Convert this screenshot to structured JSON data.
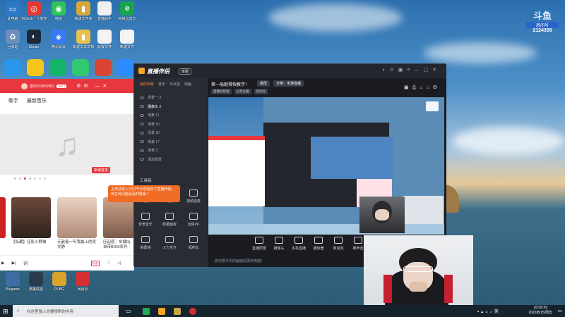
{
  "douyu": {
    "logo": "斗鱼",
    "room_label": "房间号",
    "room_number": "2124309"
  },
  "desktop_icons": [
    {
      "label": "此电脑",
      "color": "#2c79c9",
      "glyph": "▭"
    },
    {
      "label": "ToDesk一个软件",
      "color": "#e53935",
      "glyph": "◎"
    },
    {
      "label": "微信",
      "color": "#2ec35b",
      "glyph": "◉"
    },
    {
      "label": "新建文件夹",
      "color": "#d6a93a",
      "glyph": "▮"
    },
    {
      "label": "直播助手",
      "color": "#f0f0f0",
      "glyph": "▭"
    },
    {
      "label": "网易云音乐",
      "color": "#19a34a",
      "glyph": "e"
    },
    {
      "label": "回收站",
      "color": "#6d8ebd",
      "glyph": "♻"
    },
    {
      "label": "Steam",
      "color": "#1b2838",
      "glyph": "◐"
    },
    {
      "label": "腾讯会议",
      "color": "#3979f7",
      "glyph": "◈"
    },
    {
      "label": "新建文本文档",
      "color": "#e8c24a",
      "glyph": "▮"
    },
    {
      "label": "配置文件",
      "color": "#f3f3f3",
      "glyph": "▭"
    },
    {
      "label": "新建文件",
      "color": "#f3f3f3",
      "glyph": "▭"
    }
  ],
  "row3_icons": [
    {
      "color": "#2a95ea"
    },
    {
      "color": "#f5c518"
    },
    {
      "color": "#14b36a"
    },
    {
      "color": "#31c96f"
    },
    {
      "color": "#d84532"
    },
    {
      "color": "#2a8cff"
    }
  ],
  "bottom_icons": [
    {
      "label": "Wegame",
      "color": "#3d6ea3"
    },
    {
      "label": "英雄联盟",
      "color": "#2a3b4e"
    },
    {
      "label": "PUBG",
      "color": "#d8a32f"
    },
    {
      "label": "网易云",
      "color": "#d42f33"
    }
  ],
  "music": {
    "user": "音乐ID2825961",
    "vip": "VIP 1",
    "nav": [
      "歌手",
      "最新音乐"
    ],
    "badge": "新歌首发",
    "cards": [
      {
        "caption": "【私藏】佳影小野猫"
      },
      {
        "caption": "无敌者一年我最上的吴文静"
      },
      {
        "caption": "压迫感｜车载Dj 自带BGM系列"
      }
    ],
    "play_label": "词",
    "tag": "标准"
  },
  "app": {
    "name": "直播伴侣",
    "badge": "体验",
    "scene_title": "第一局跑得快教学！",
    "scene_btn": "修改",
    "category": "分类：手游直播",
    "sub_tabs": [
      "直播间管理",
      "分享主播",
      "房间号"
    ],
    "tabs": [
      "我的场景",
      "音乐",
      "可点击",
      "动画"
    ],
    "scenes": [
      "场景一 3",
      "摄像头 2",
      "场景 11",
      "场景 15",
      "场景 16",
      "场景 17",
      "场景 3",
      "添加场景"
    ],
    "tools_title": "工具箱",
    "tools": [
      [
        "美颜",
        "礼物",
        "视频连麦"
      ],
      [
        "背景音乐",
        "数据面板",
        "全民PK"
      ],
      [
        "弹幕墙",
        "火力全开",
        "福利红"
      ]
    ],
    "toast": "上周总收入2万1千分享给你了直播伴侣，有任何问题请及时联系！",
    "bottom_btns": [
      "直播屏幕",
      "摄像头",
      "多机直播",
      "播放器",
      "麦克风",
      "推声音"
    ],
    "footer": "如何把手机的画面投屏到电脑？"
  },
  "taskbar": {
    "search": "在这里输入你要搜索的内容",
    "time": "16:59:29",
    "date": "2022/8/15/周五"
  }
}
